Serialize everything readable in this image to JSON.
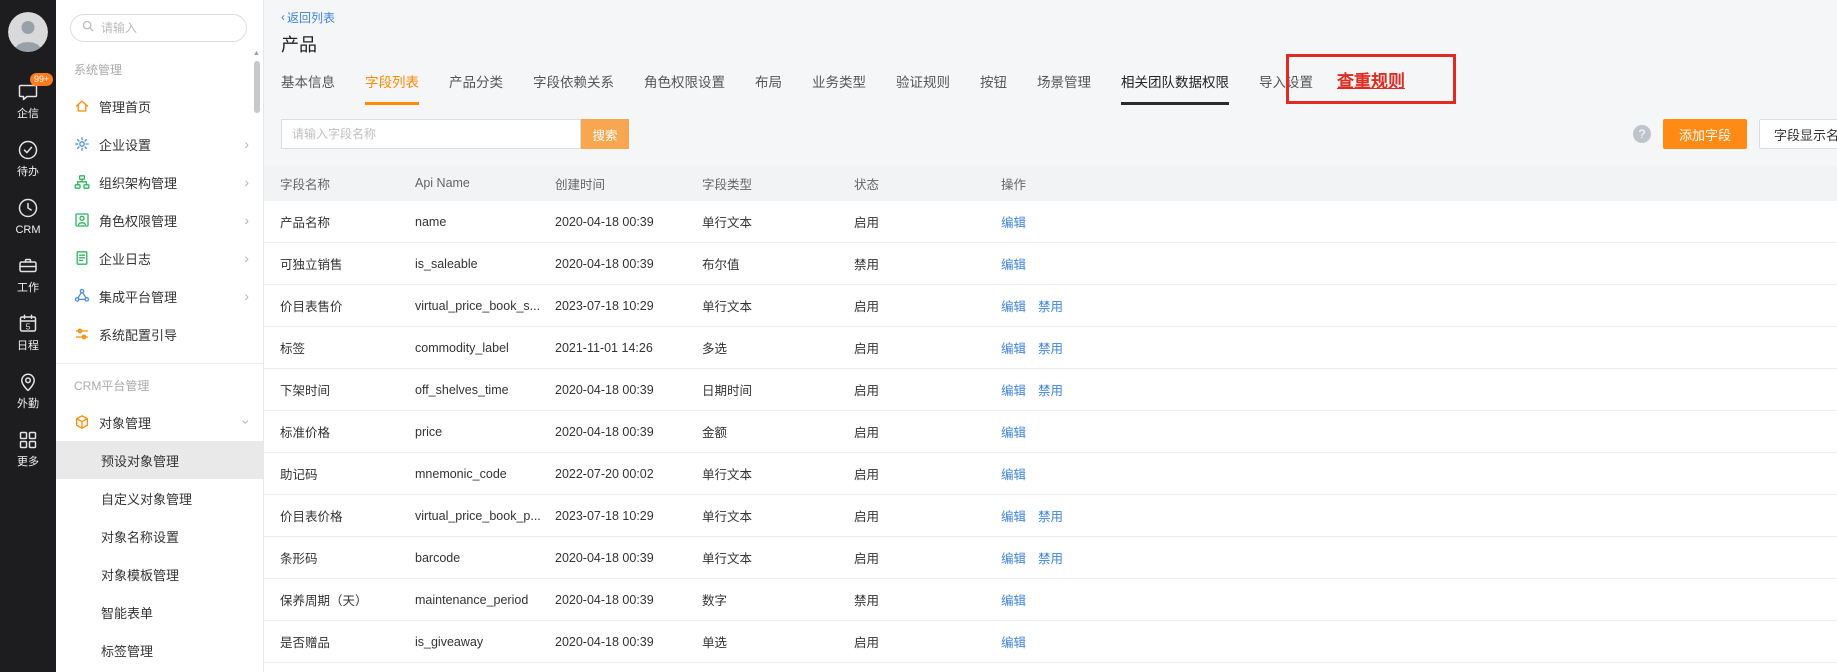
{
  "colors": {
    "accent_orange": "#ff8a00",
    "search_button_orange": "#f7a750",
    "add_button_orange": "#ff8a14",
    "link_blue": "#3e84e0",
    "annotation_red": "#e02b20",
    "badge_orange": "#ff7b1c",
    "rail_background": "#1d1d1f",
    "selected_item_background": "#e9e9e9"
  },
  "rail": {
    "avatar_icon": "user-avatar",
    "items": [
      {
        "label": "企信",
        "icon": "chat-icon",
        "badge": "99+"
      },
      {
        "label": "待办",
        "icon": "todo-icon"
      },
      {
        "label": "CRM",
        "icon": "clock-icon"
      },
      {
        "label": "工作",
        "icon": "work-icon"
      },
      {
        "label": "日程",
        "icon": "calendar-icon",
        "day": "5"
      },
      {
        "label": "外勤",
        "icon": "location-icon"
      },
      {
        "label": "更多",
        "icon": "more-grid-icon"
      }
    ]
  },
  "sidebar": {
    "search_placeholder": "请输入",
    "sections": {
      "system": {
        "title": "系统管理",
        "items": [
          {
            "label": "管理首页",
            "icon": "home-icon",
            "color": "#ff8a00"
          },
          {
            "label": "企业设置",
            "icon": "gear-icon",
            "color": "#4a90e2",
            "chevron_right": true
          },
          {
            "label": "组织架构管理",
            "icon": "org-chart-icon",
            "color": "#2fb45f",
            "chevron_right": true
          },
          {
            "label": "角色权限管理",
            "icon": "role-icon",
            "color": "#2fb45f",
            "chevron_right": true
          },
          {
            "label": "企业日志",
            "icon": "log-icon",
            "color": "#2fb45f",
            "chevron_right": true
          },
          {
            "label": "集成平台管理",
            "icon": "integration-icon",
            "color": "#4a90e2",
            "chevron_right": true
          },
          {
            "label": "系统配置引导",
            "icon": "config-icon",
            "color": "#ff8a00"
          }
        ]
      },
      "crm": {
        "title": "CRM平台管理",
        "items": [
          {
            "label": "对象管理",
            "icon": "object-cube-icon",
            "color": "#ff8a00",
            "chevron_down": true
          },
          {
            "label": "预设对象管理",
            "sub": true,
            "selected": true
          },
          {
            "label": "自定义对象管理",
            "sub": true
          },
          {
            "label": "对象名称设置",
            "sub": true
          },
          {
            "label": "对象模板管理",
            "sub": true
          },
          {
            "label": "智能表单",
            "sub": true
          },
          {
            "label": "标签管理",
            "sub": true,
            "partial": true
          }
        ]
      }
    }
  },
  "header": {
    "back_label": "返回列表",
    "title": "产品"
  },
  "tabs": [
    {
      "label": "基本信息"
    },
    {
      "label": "字段列表",
      "active": true
    },
    {
      "label": "产品分类"
    },
    {
      "label": "字段依赖关系"
    },
    {
      "label": "角色权限设置"
    },
    {
      "label": "布局"
    },
    {
      "label": "业务类型"
    },
    {
      "label": "验证规则"
    },
    {
      "label": "按钮"
    },
    {
      "label": "场景管理"
    },
    {
      "label": "相关团队数据权限",
      "dark_underline": true
    },
    {
      "label": "导入设置"
    }
  ],
  "annotation": {
    "label": "查重规则"
  },
  "toolbar": {
    "search_placeholder": "请输入字段名称",
    "search_button": "搜索",
    "help_icon": "?",
    "add_field_button": "添加字段",
    "display_name_button": "字段显示名称"
  },
  "table": {
    "columns": [
      "字段名称",
      "Api Name",
      "创建时间",
      "字段类型",
      "状态",
      "操作"
    ],
    "rows": [
      {
        "name": "产品名称",
        "api": "name",
        "created": "2020-04-18 00:39",
        "type": "单行文本",
        "status": "启用",
        "edit": "编辑"
      },
      {
        "name": "可独立销售",
        "api": "is_saleable",
        "created": "2020-04-18 00:39",
        "type": "布尔值",
        "status": "禁用",
        "edit": "编辑"
      },
      {
        "name": "价目表售价",
        "api": "virtual_price_book_s...",
        "created": "2023-07-18 10:29",
        "type": "单行文本",
        "status": "启用",
        "edit": "编辑",
        "disable": "禁用"
      },
      {
        "name": "标签",
        "api": "commodity_label",
        "created": "2021-11-01 14:26",
        "type": "多选",
        "status": "启用",
        "edit": "编辑",
        "disable": "禁用"
      },
      {
        "name": "下架时间",
        "api": "off_shelves_time",
        "created": "2020-04-18 00:39",
        "type": "日期时间",
        "status": "启用",
        "edit": "编辑",
        "disable": "禁用"
      },
      {
        "name": "标准价格",
        "api": "price",
        "created": "2020-04-18 00:39",
        "type": "金额",
        "status": "启用",
        "edit": "编辑"
      },
      {
        "name": "助记码",
        "api": "mnemonic_code",
        "created": "2022-07-20 00:02",
        "type": "单行文本",
        "status": "启用",
        "edit": "编辑"
      },
      {
        "name": "价目表价格",
        "api": "virtual_price_book_p...",
        "created": "2023-07-18 10:29",
        "type": "单行文本",
        "status": "启用",
        "edit": "编辑",
        "disable": "禁用"
      },
      {
        "name": "条形码",
        "api": "barcode",
        "created": "2020-04-18 00:39",
        "type": "单行文本",
        "status": "启用",
        "edit": "编辑",
        "disable": "禁用"
      },
      {
        "name": "保养周期（天）",
        "api": "maintenance_period",
        "created": "2020-04-18 00:39",
        "type": "数字",
        "status": "禁用",
        "edit": "编辑"
      },
      {
        "name": "是否赠品",
        "api": "is_giveaway",
        "created": "2020-04-18 00:39",
        "type": "单选",
        "status": "启用",
        "edit": "编辑"
      }
    ]
  }
}
